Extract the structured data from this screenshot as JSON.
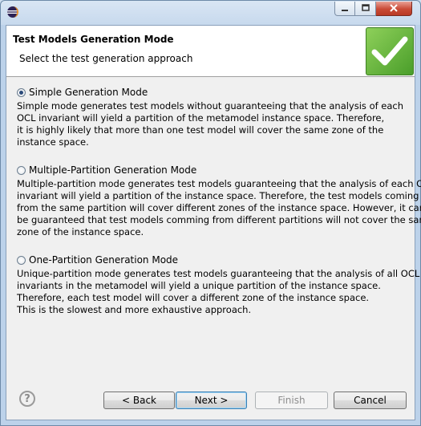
{
  "window": {
    "title": ""
  },
  "header": {
    "title": "Test Models Generation Mode",
    "subtitle": "Select the test generation approach"
  },
  "options": [
    {
      "label": "Simple Generation Mode",
      "selected": true,
      "description": [
        "Simple mode generates test models without guaranteeing that the analysis of each",
        "OCL invariant will yield a partition of the metamodel instance space. Therefore,",
        "it is highly likely that more than one test model will cover the same zone of the",
        "instance space."
      ]
    },
    {
      "label": "Multiple-Partition Generation Mode",
      "selected": false,
      "description": [
        "Multiple-partition mode generates test models guaranteeing that the analysis of each OCL",
        "invariant will yield a partition of the instance space. Therefore, the test models coming",
        "from the same partition will cover different zones of the instance space. However, it cannot",
        "be guaranteed that test models comming from different partitions will not cover the same",
        "zone of the instance space."
      ]
    },
    {
      "label": "One-Partition Generation Mode",
      "selected": false,
      "description": [
        "Unique-partition mode generates test models guaranteeing that the analysis of all OCL",
        "invariants in the metamodel will yield a unique partition of the instance space.",
        "Therefore, each test model will cover a different zone of the instance space.",
        "This is the slowest and more exhaustive approach."
      ]
    }
  ],
  "buttons": {
    "back": "< Back",
    "next": "Next >",
    "finish": "Finish",
    "cancel": "Cancel",
    "help": "?"
  },
  "icons": {
    "app": "eclipse-icon",
    "minimize": "minimize-icon",
    "maximize": "maximize-icon",
    "close": "close-icon",
    "banner": "checkmark-icon"
  },
  "colors": {
    "banner_green": "#5aaf34",
    "close_red": "#c94a36",
    "title_bar": "#c7d9ed"
  }
}
